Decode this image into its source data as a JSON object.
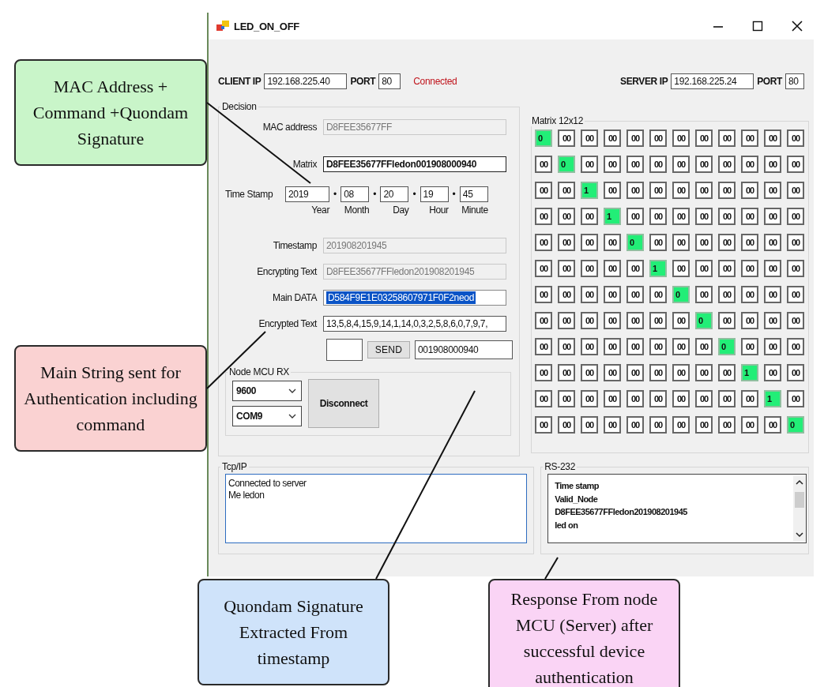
{
  "window": {
    "title": "LED_ON_OFF"
  },
  "connection": {
    "client_ip_label": "CLIENT  IP",
    "client_ip": "192.168.225.40",
    "client_port_label": "PORT",
    "client_port": "80",
    "status": "Connected",
    "server_ip_label": "SERVER IP",
    "server_ip": "192.168.225.24",
    "server_port_label": "PORT",
    "server_port": "80"
  },
  "decision": {
    "title": "Decision",
    "rows": [
      {
        "kind": "readonly",
        "label": "MAC address",
        "value": "D8FEE35677FF"
      },
      {
        "kind": "emphasis",
        "label": "Matrix",
        "value": "D8FEE35677FFledon001908000940"
      },
      {
        "kind": "time",
        "label": "Time Stamp",
        "parts": [
          {
            "value": "2019",
            "caption": "Year"
          },
          {
            "separator": "•",
            "value": "08",
            "caption": "Month"
          },
          {
            "separator": "•",
            "value": "20",
            "caption": "Day"
          },
          {
            "separator": "•",
            "value": "19",
            "caption": "Hour"
          },
          {
            "separator": "•",
            "value": "45",
            "caption": "Minute"
          }
        ]
      },
      {
        "kind": "readonly",
        "label": "Timestamp",
        "value": "201908201945"
      },
      {
        "kind": "readonly",
        "label": "Encrypting Text",
        "value": "D8FEE35677FFledon201908201945"
      },
      {
        "kind": "highlighted",
        "label": "Main DATA",
        "value": "D584F9E1E03258607971F0F2neod"
      },
      {
        "kind": "plain",
        "label": "Encrypted Text",
        "value": "13,5,8,4,15,9,14,1,14,0,3,2,5,8,6,0,7,9,7,"
      }
    ],
    "send_button": "SEND",
    "signature": "001908000940",
    "node_mcu": {
      "title": "Node MCU RX",
      "baud": "9600",
      "port": "COM9",
      "button": "Disconnect"
    }
  },
  "matrix": {
    "title": "Matrix 12x12",
    "rows": [
      [
        {
          "text": "0",
          "highlighted": true
        },
        {
          "text": "00",
          "highlighted": false
        },
        {
          "text": "00",
          "highlighted": false
        },
        {
          "text": "00",
          "highlighted": false
        },
        {
          "text": "00",
          "highlighted": false
        },
        {
          "text": "00",
          "highlighted": false
        },
        {
          "text": "00",
          "highlighted": false
        },
        {
          "text": "00",
          "highlighted": false
        },
        {
          "text": "00",
          "highlighted": false
        },
        {
          "text": "00",
          "highlighted": false
        },
        {
          "text": "00",
          "highlighted": false
        },
        {
          "text": "00",
          "highlighted": false
        }
      ],
      [
        {
          "text": "00",
          "highlighted": false
        },
        {
          "text": "0",
          "highlighted": true
        },
        {
          "text": "00",
          "highlighted": false
        },
        {
          "text": "00",
          "highlighted": false
        },
        {
          "text": "00",
          "highlighted": false
        },
        {
          "text": "00",
          "highlighted": false
        },
        {
          "text": "00",
          "highlighted": false
        },
        {
          "text": "00",
          "highlighted": false
        },
        {
          "text": "00",
          "highlighted": false
        },
        {
          "text": "00",
          "highlighted": false
        },
        {
          "text": "00",
          "highlighted": false
        },
        {
          "text": "00",
          "highlighted": false
        }
      ],
      [
        {
          "text": "00",
          "highlighted": false
        },
        {
          "text": "00",
          "highlighted": false
        },
        {
          "text": "1",
          "highlighted": true
        },
        {
          "text": "00",
          "highlighted": false
        },
        {
          "text": "00",
          "highlighted": false
        },
        {
          "text": "00",
          "highlighted": false
        },
        {
          "text": "00",
          "highlighted": false
        },
        {
          "text": "00",
          "highlighted": false
        },
        {
          "text": "00",
          "highlighted": false
        },
        {
          "text": "00",
          "highlighted": false
        },
        {
          "text": "00",
          "highlighted": false
        },
        {
          "text": "00",
          "highlighted": false
        }
      ],
      [
        {
          "text": "00",
          "highlighted": false
        },
        {
          "text": "00",
          "highlighted": false
        },
        {
          "text": "00",
          "highlighted": false
        },
        {
          "text": "1",
          "highlighted": true
        },
        {
          "text": "00",
          "highlighted": false
        },
        {
          "text": "00",
          "highlighted": false
        },
        {
          "text": "00",
          "highlighted": false
        },
        {
          "text": "00",
          "highlighted": false
        },
        {
          "text": "00",
          "highlighted": false
        },
        {
          "text": "00",
          "highlighted": false
        },
        {
          "text": "00",
          "highlighted": false
        },
        {
          "text": "00",
          "highlighted": false
        }
      ],
      [
        {
          "text": "00",
          "highlighted": false
        },
        {
          "text": "00",
          "highlighted": false
        },
        {
          "text": "00",
          "highlighted": false
        },
        {
          "text": "00",
          "highlighted": false
        },
        {
          "text": "0",
          "highlighted": true
        },
        {
          "text": "00",
          "highlighted": false
        },
        {
          "text": "00",
          "highlighted": false
        },
        {
          "text": "00",
          "highlighted": false
        },
        {
          "text": "00",
          "highlighted": false
        },
        {
          "text": "00",
          "highlighted": false
        },
        {
          "text": "00",
          "highlighted": false
        },
        {
          "text": "00",
          "highlighted": false
        }
      ],
      [
        {
          "text": "00",
          "highlighted": false
        },
        {
          "text": "00",
          "highlighted": false
        },
        {
          "text": "00",
          "highlighted": false
        },
        {
          "text": "00",
          "highlighted": false
        },
        {
          "text": "00",
          "highlighted": false
        },
        {
          "text": "1",
          "highlighted": true
        },
        {
          "text": "00",
          "highlighted": false
        },
        {
          "text": "00",
          "highlighted": false
        },
        {
          "text": "00",
          "highlighted": false
        },
        {
          "text": "00",
          "highlighted": false
        },
        {
          "text": "00",
          "highlighted": false
        },
        {
          "text": "00",
          "highlighted": false
        }
      ],
      [
        {
          "text": "00",
          "highlighted": false
        },
        {
          "text": "00",
          "highlighted": false
        },
        {
          "text": "00",
          "highlighted": false
        },
        {
          "text": "00",
          "highlighted": false
        },
        {
          "text": "00",
          "highlighted": false
        },
        {
          "text": "00",
          "highlighted": false
        },
        {
          "text": "0",
          "highlighted": true
        },
        {
          "text": "00",
          "highlighted": false
        },
        {
          "text": "00",
          "highlighted": false
        },
        {
          "text": "00",
          "highlighted": false
        },
        {
          "text": "00",
          "highlighted": false
        },
        {
          "text": "00",
          "highlighted": false
        }
      ],
      [
        {
          "text": "00",
          "highlighted": false
        },
        {
          "text": "00",
          "highlighted": false
        },
        {
          "text": "00",
          "highlighted": false
        },
        {
          "text": "00",
          "highlighted": false
        },
        {
          "text": "00",
          "highlighted": false
        },
        {
          "text": "00",
          "highlighted": false
        },
        {
          "text": "00",
          "highlighted": false
        },
        {
          "text": "0",
          "highlighted": true
        },
        {
          "text": "00",
          "highlighted": false
        },
        {
          "text": "00",
          "highlighted": false
        },
        {
          "text": "00",
          "highlighted": false
        },
        {
          "text": "00",
          "highlighted": false
        }
      ],
      [
        {
          "text": "00",
          "highlighted": false
        },
        {
          "text": "00",
          "highlighted": false
        },
        {
          "text": "00",
          "highlighted": false
        },
        {
          "text": "00",
          "highlighted": false
        },
        {
          "text": "00",
          "highlighted": false
        },
        {
          "text": "00",
          "highlighted": false
        },
        {
          "text": "00",
          "highlighted": false
        },
        {
          "text": "00",
          "highlighted": false
        },
        {
          "text": "0",
          "highlighted": true
        },
        {
          "text": "00",
          "highlighted": false
        },
        {
          "text": "00",
          "highlighted": false
        },
        {
          "text": "00",
          "highlighted": false
        }
      ],
      [
        {
          "text": "00",
          "highlighted": false
        },
        {
          "text": "00",
          "highlighted": false
        },
        {
          "text": "00",
          "highlighted": false
        },
        {
          "text": "00",
          "highlighted": false
        },
        {
          "text": "00",
          "highlighted": false
        },
        {
          "text": "00",
          "highlighted": false
        },
        {
          "text": "00",
          "highlighted": false
        },
        {
          "text": "00",
          "highlighted": false
        },
        {
          "text": "00",
          "highlighted": false
        },
        {
          "text": "1",
          "highlighted": true
        },
        {
          "text": "00",
          "highlighted": false
        },
        {
          "text": "00",
          "highlighted": false
        }
      ],
      [
        {
          "text": "00",
          "highlighted": false
        },
        {
          "text": "00",
          "highlighted": false
        },
        {
          "text": "00",
          "highlighted": false
        },
        {
          "text": "00",
          "highlighted": false
        },
        {
          "text": "00",
          "highlighted": false
        },
        {
          "text": "00",
          "highlighted": false
        },
        {
          "text": "00",
          "highlighted": false
        },
        {
          "text": "00",
          "highlighted": false
        },
        {
          "text": "00",
          "highlighted": false
        },
        {
          "text": "00",
          "highlighted": false
        },
        {
          "text": "1",
          "highlighted": true
        },
        {
          "text": "00",
          "highlighted": false
        }
      ],
      [
        {
          "text": "00",
          "highlighted": false
        },
        {
          "text": "00",
          "highlighted": false
        },
        {
          "text": "00",
          "highlighted": false
        },
        {
          "text": "00",
          "highlighted": false
        },
        {
          "text": "00",
          "highlighted": false
        },
        {
          "text": "00",
          "highlighted": false
        },
        {
          "text": "00",
          "highlighted": false
        },
        {
          "text": "00",
          "highlighted": false
        },
        {
          "text": "00",
          "highlighted": false
        },
        {
          "text": "00",
          "highlighted": false
        },
        {
          "text": "00",
          "highlighted": false
        },
        {
          "text": "0",
          "highlighted": true
        }
      ]
    ]
  },
  "tcp_ip": {
    "title": "Tcp/IP",
    "lines": [
      "Connected to server",
      "Me ledon"
    ]
  },
  "rs232": {
    "title": "RS-232",
    "lines": [
      "Time stamp",
      "Valid_Node",
      "D8FEE35677FFledon201908201945",
      "led on"
    ]
  },
  "callouts": [
    {
      "text": "MAC Address + Command +Quondam Signature",
      "color": "#c9f5c9"
    },
    {
      "text": "Main String sent for Authentication including command",
      "color": "#fad2d2"
    },
    {
      "text": "Quondam Signature Extracted From timestamp",
      "color": "#cfe3fa"
    },
    {
      "text": "Response From node MCU (Server) after successful device authentication",
      "color": "#fad4f5"
    }
  ]
}
